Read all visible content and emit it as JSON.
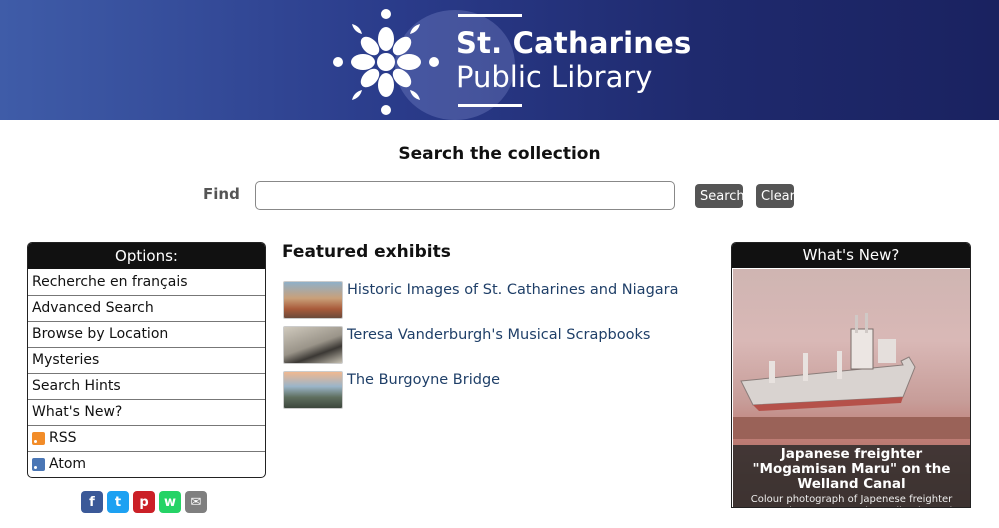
{
  "header": {
    "logo_line1": "St. Catharines",
    "logo_line2": "Public Library"
  },
  "search": {
    "heading": "Search the collection",
    "find_label": "Find",
    "input_value": "",
    "search_label": "Search",
    "clear_label": "Clear"
  },
  "options": {
    "title": "Options:",
    "items": [
      {
        "label": "Recherche en français"
      },
      {
        "label": "Advanced Search"
      },
      {
        "label": "Browse by Location"
      },
      {
        "label": "Mysteries"
      },
      {
        "label": "Search Hints"
      },
      {
        "label": "What's New?"
      },
      {
        "label": "RSS",
        "icon": "rss-icon"
      },
      {
        "label": "Atom",
        "icon": "atom-icon"
      }
    ]
  },
  "social": [
    {
      "icon": "facebook-icon",
      "glyph": "f",
      "color": "#3b5998"
    },
    {
      "icon": "twitter-icon",
      "glyph": "t",
      "color": "#1da1f2"
    },
    {
      "icon": "pinterest-icon",
      "glyph": "p",
      "color": "#cb2027"
    },
    {
      "icon": "whatsapp-icon",
      "glyph": "w",
      "color": "#25d366"
    },
    {
      "icon": "email-icon",
      "glyph": "✉",
      "color": "#7f7f7f"
    }
  ],
  "featured": {
    "heading": "Featured exhibits",
    "items": [
      {
        "title": "Historic Images of St. Catharines and Niagara"
      },
      {
        "title": "Teresa Vanderburgh's Musical Scrapbooks"
      },
      {
        "title": "The Burgoyne Bridge"
      }
    ]
  },
  "whats_new": {
    "title": "What's New?",
    "caption_title": "Japanese freighter \"Mogamisan Maru\" on the Welland Canal",
    "caption_body": "Colour photograph of Japenese freighter \"Mogamisan Maru\" on the Welland Canal, October, 1963 File Number: 19.1.1/2014.6"
  },
  "colors": {
    "banner_start": "#3f5ca8",
    "banner_end": "#1a2260",
    "link": "#1f3f68",
    "button": "#555555"
  }
}
